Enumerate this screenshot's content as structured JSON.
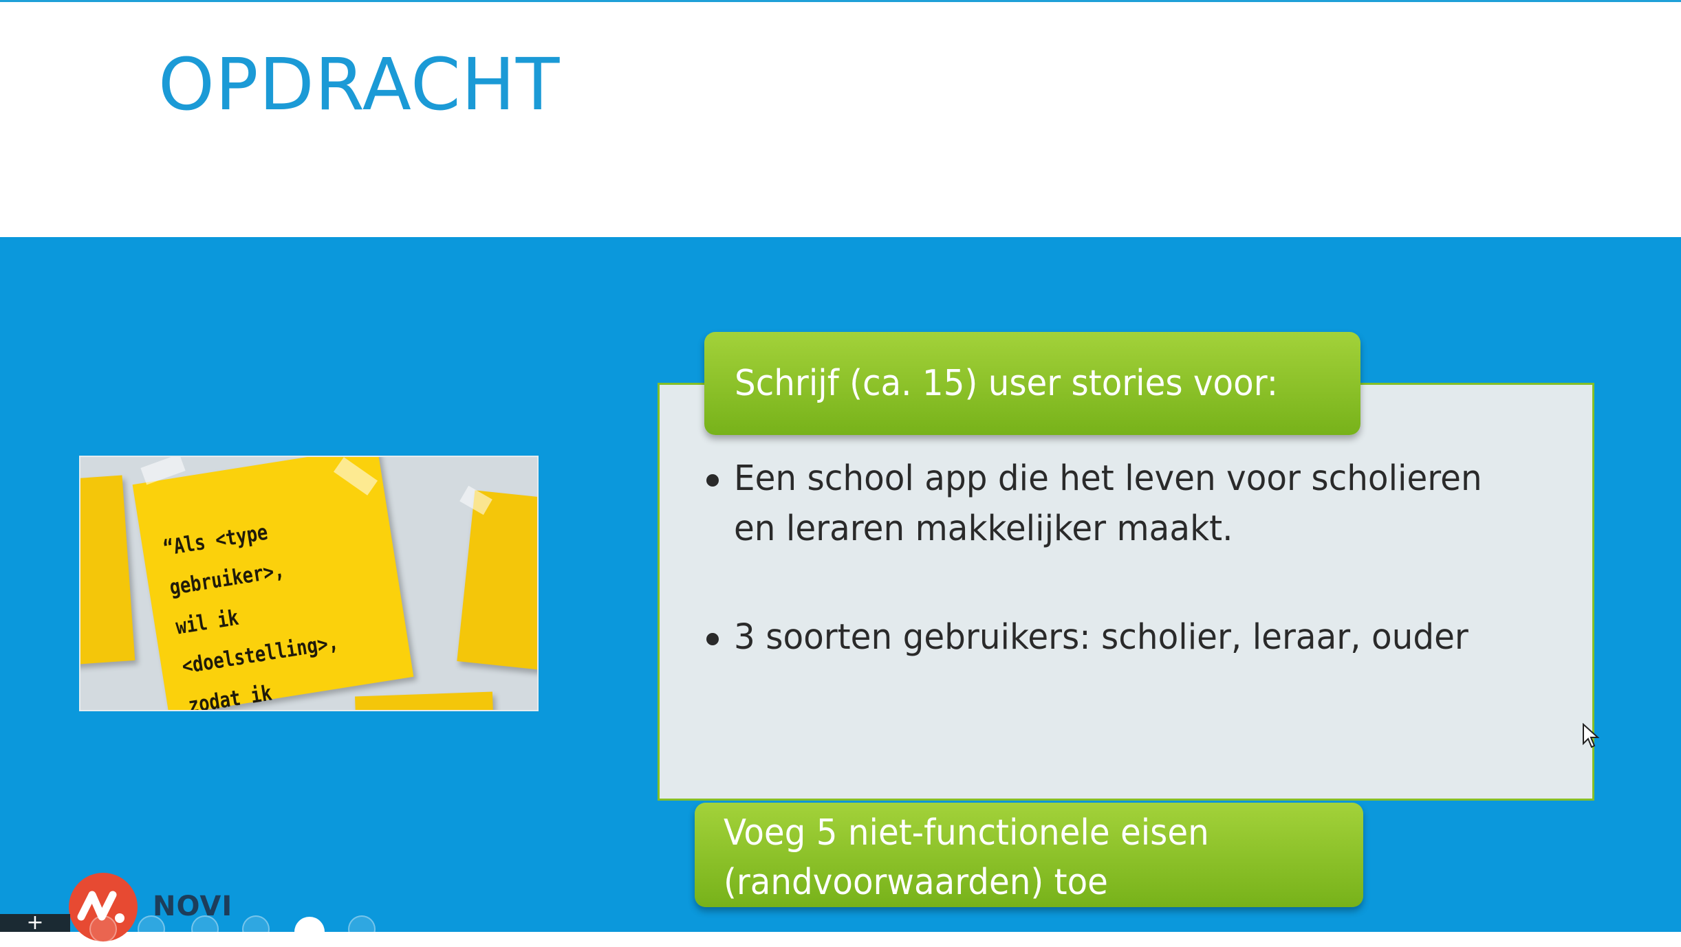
{
  "slide": {
    "title": "OPDRACHT",
    "sticky_note_text": "“Als <type gebruiker>,\nwil ik <doelstelling>,\nzodat ik <reden>”.",
    "top_label": "Schrijf (ca. 15) user stories voor:",
    "bullets": [
      "Een school app die het leven voor scholieren en leraren makkelijker maakt.",
      "3 soorten gebruikers: scholier, leraar, ouder"
    ],
    "bottom_label_line1": "Voeg 5 niet-functionele eisen",
    "bottom_label_line2": "(randvoorwaarden) toe",
    "brand": "NOVI"
  },
  "colors": {
    "title": "#1b9ad6",
    "background_blue": "#0b98dc",
    "label_green": "#8dc22a",
    "box_fill": "#e3eaed",
    "note_yellow": "#fbd10c",
    "logo_red": "#e74a32"
  },
  "toolbar": {
    "icons": [
      "add-icon",
      "pen-icon",
      "highlighter-icon",
      "zoom-icon",
      "subtitles-icon",
      "camera-icon",
      "more-icon"
    ],
    "add_symbol": "+"
  }
}
